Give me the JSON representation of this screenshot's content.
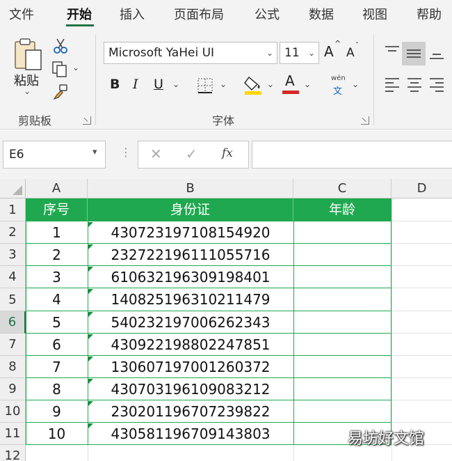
{
  "menu": {
    "tabs": [
      "文件",
      "开始",
      "插入",
      "页面布局",
      "公式",
      "数据",
      "视图",
      "帮助"
    ]
  },
  "ribbon": {
    "clipboard": {
      "paste_label": "粘贴",
      "group_label": "剪贴板"
    },
    "font": {
      "font_name": "Microsoft YaHei UI",
      "font_size": "11",
      "bold": "B",
      "italic": "I",
      "underline": "U",
      "font_color_glyph": "A",
      "grow_glyph": "A",
      "shrink_glyph": "A",
      "phonetic_top": "wén",
      "phonetic_bottom": "文",
      "group_label": "字体",
      "fill_color": "#ffd700",
      "font_color": "#d62828"
    }
  },
  "formula_bar": {
    "name_box": "E6",
    "fx": "fx",
    "content": ""
  },
  "sheet": {
    "columns": [
      "A",
      "B",
      "C",
      "D"
    ],
    "rows": [
      "1",
      "2",
      "3",
      "4",
      "5",
      "6",
      "7",
      "8",
      "9",
      "10",
      "11",
      "12"
    ],
    "selected_row": "6",
    "accent_color": "#1fa84f",
    "header": {
      "seq": "序号",
      "id": "身份证",
      "age": "年龄"
    },
    "records": [
      {
        "seq": "1",
        "id": "430723197108154920"
      },
      {
        "seq": "2",
        "id": "232722196111055716"
      },
      {
        "seq": "3",
        "id": "610632196309198401"
      },
      {
        "seq": "4",
        "id": "140825196310211479"
      },
      {
        "seq": "5",
        "id": "540232197006262343"
      },
      {
        "seq": "6",
        "id": "430922198802247851"
      },
      {
        "seq": "7",
        "id": "130607197001260372"
      },
      {
        "seq": "8",
        "id": "430703196109083212"
      },
      {
        "seq": "9",
        "id": "230201196707239822"
      },
      {
        "seq": "10",
        "id": "430581196709143803"
      }
    ]
  },
  "watermark": "易坊好文馆"
}
